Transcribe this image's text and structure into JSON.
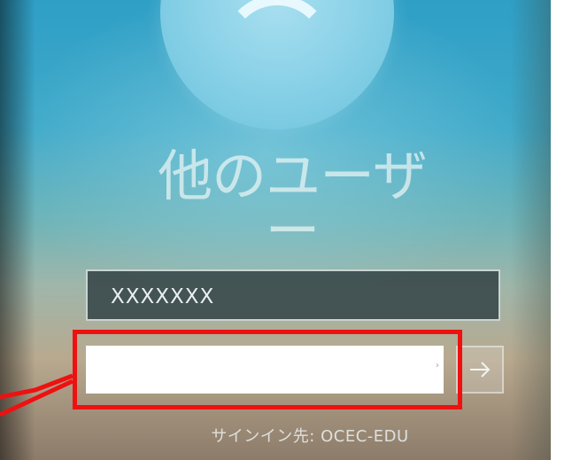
{
  "login_screen": {
    "title": "他のユーザー",
    "username_value": "XXXXXXX",
    "password_value": "",
    "signin_to": "サインイン先: OCEC-EDU"
  },
  "icons": {
    "avatar": "default-user-avatar-icon",
    "reveal": "password-reveal-icon",
    "submit": "right-arrow-icon"
  },
  "annotation": {
    "highlight_color": "#ee1111"
  }
}
